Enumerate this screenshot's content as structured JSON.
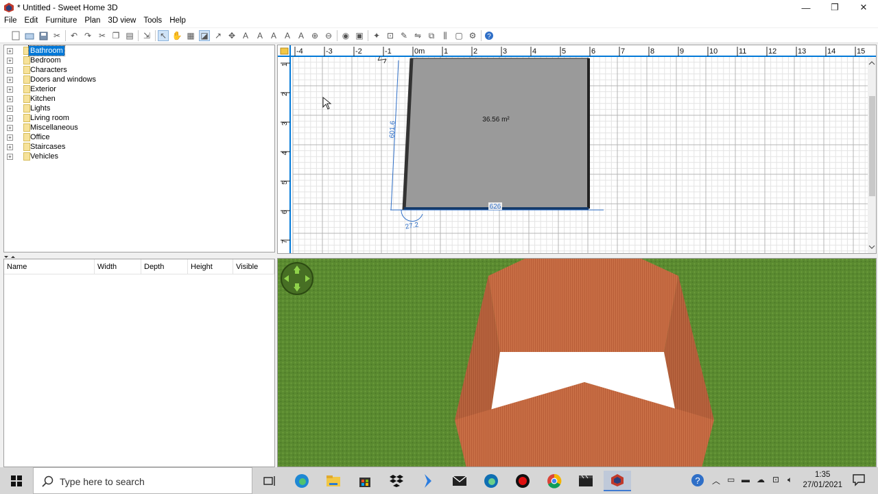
{
  "window": {
    "title": "* Untitled - Sweet Home 3D",
    "minimize": "—",
    "maximize": "❐",
    "close": "✕"
  },
  "menu": [
    "File",
    "Edit",
    "Furniture",
    "Plan",
    "3D view",
    "Tools",
    "Help"
  ],
  "catalog": {
    "categories": [
      "Bathroom",
      "Bedroom",
      "Characters",
      "Doors and windows",
      "Exterior",
      "Kitchen",
      "Lights",
      "Living room",
      "Miscellaneous",
      "Office",
      "Staircases",
      "Vehicles"
    ],
    "selected": "Bathroom"
  },
  "furniture_table": {
    "columns": [
      "Name",
      "Width",
      "Depth",
      "Height",
      "Visible"
    ]
  },
  "plan": {
    "ruler_x": [
      "-4",
      "-3",
      "-2",
      "-1",
      "0m",
      "1",
      "2",
      "3",
      "4",
      "5",
      "6",
      "7",
      "8",
      "9",
      "10",
      "11",
      "12",
      "13",
      "14",
      "15"
    ],
    "ruler_y": [
      "1",
      "2",
      "3",
      "4",
      "5",
      "6",
      "7"
    ],
    "room_area": "36.56 m²",
    "dimension_vertical": "601.6",
    "dimension_horizontal": "626",
    "angle_label": "27.2"
  },
  "taskbar": {
    "search_placeholder": "Type here to search",
    "time": "1:35",
    "date": "27/01/2021"
  },
  "colors": {
    "accent": "#0078d7",
    "grass": "#5a8a30",
    "wall": "#c86e45",
    "floor": "#ffffff"
  }
}
